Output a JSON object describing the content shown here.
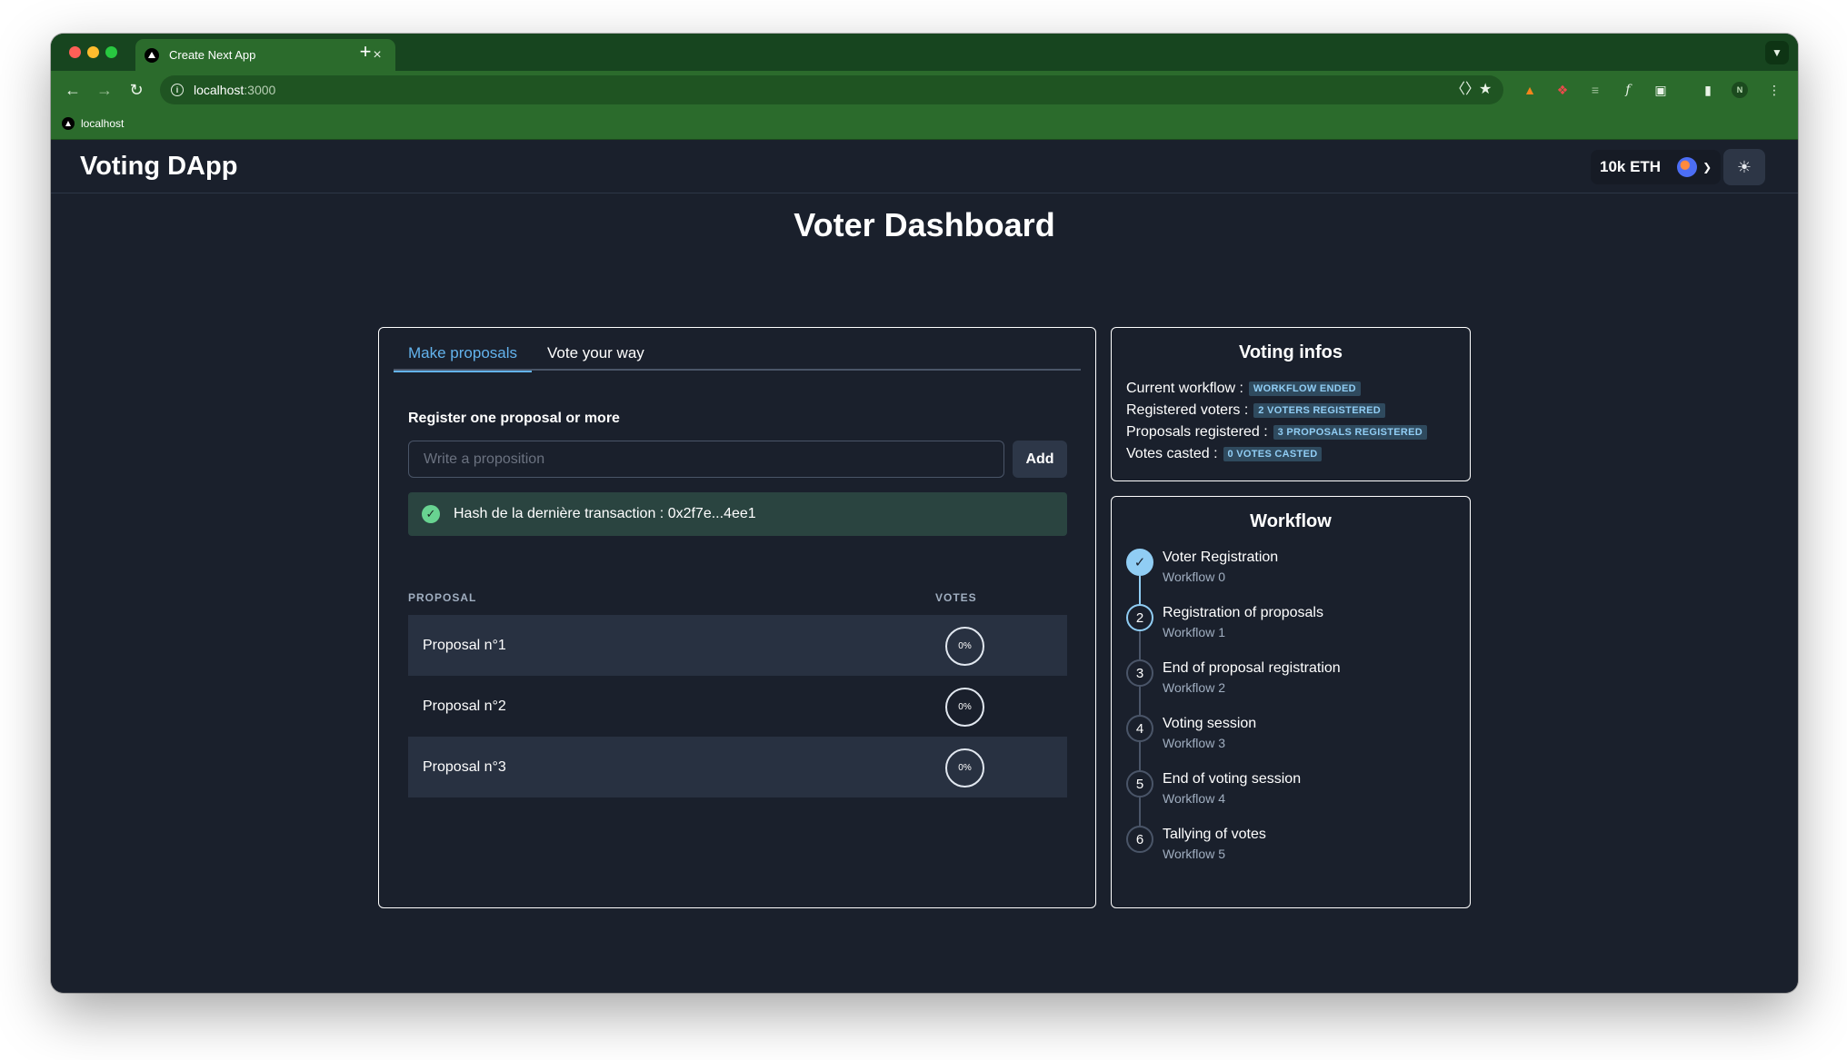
{
  "browser": {
    "tab_title": "Create Next App",
    "tab_close": "×",
    "new_tab": "+",
    "url_host": "localhost",
    "url_port": ":3000",
    "bookmark": "localhost",
    "profile_initial": "N"
  },
  "header": {
    "title": "Voting DApp",
    "balance": "10k ETH"
  },
  "page": {
    "title": "Voter Dashboard"
  },
  "tabs": [
    {
      "label": "Make proposals",
      "active": true
    },
    {
      "label": "Vote your way",
      "active": false
    }
  ],
  "proposals_form": {
    "label": "Register one proposal or more",
    "placeholder": "Write a proposition",
    "add_label": "Add",
    "alert_text": "Hash de la dernière transaction : 0x2f7e...4ee1"
  },
  "table": {
    "col_proposal": "PROPOSAL",
    "col_votes": "VOTES",
    "rows": [
      {
        "label": "Proposal n°1",
        "votes": "0%"
      },
      {
        "label": "Proposal n°2",
        "votes": "0%"
      },
      {
        "label": "Proposal n°3",
        "votes": "0%"
      }
    ]
  },
  "voting_infos": {
    "title": "Voting infos",
    "lines": [
      {
        "label": "Current workflow :",
        "badge": "WORKFLOW ENDED"
      },
      {
        "label": "Registered voters :",
        "badge": "2 VOTERS REGISTERED"
      },
      {
        "label": "Proposals registered :",
        "badge": "3 PROPOSALS REGISTERED"
      },
      {
        "label": "Votes casted :",
        "badge": "0 VOTES CASTED"
      }
    ]
  },
  "workflow": {
    "title": "Workflow",
    "steps": [
      {
        "num": "✓",
        "title": "Voter Registration",
        "sub": "Workflow 0",
        "state": "done"
      },
      {
        "num": "2",
        "title": "Registration of proposals",
        "sub": "Workflow 1",
        "state": "current"
      },
      {
        "num": "3",
        "title": "End of proposal registration",
        "sub": "Workflow 2",
        "state": "pending"
      },
      {
        "num": "4",
        "title": "Voting session",
        "sub": "Workflow 3",
        "state": "pending"
      },
      {
        "num": "5",
        "title": "End of voting session",
        "sub": "Workflow 4",
        "state": "pending"
      },
      {
        "num": "6",
        "title": "Tallying of votes",
        "sub": "Workflow 5",
        "state": "pending"
      }
    ]
  },
  "colors": {
    "browser_frame": "#17451f",
    "browser_toolbar": "#2b6b2c",
    "app_bg": "#1a202c",
    "accent": "#63b3ed",
    "badge_text": "#90cdf4",
    "success": "#68d391"
  }
}
